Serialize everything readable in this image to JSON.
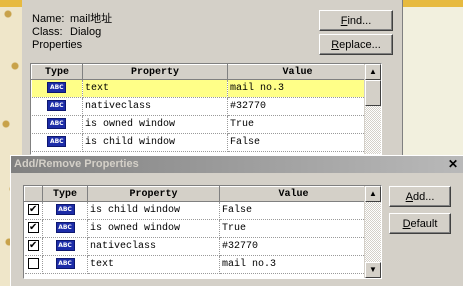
{
  "properties_window": {
    "name_label": "Name:",
    "name_value": "mail地址",
    "class_label": "Class:",
    "class_value": "Dialog",
    "properties_label": "Properties",
    "find_button": "Find...",
    "replace_button": "Replace...",
    "columns": [
      "Type",
      "Property",
      "Value"
    ],
    "rows": [
      {
        "type": "ABC",
        "property": "text",
        "value": "mail no.3",
        "selected": true
      },
      {
        "type": "ABC",
        "property": "nativeclass",
        "value": "#32770",
        "selected": false
      },
      {
        "type": "ABC",
        "property": "is owned window",
        "value": "True",
        "selected": false
      },
      {
        "type": "ABC",
        "property": "is child window",
        "value": "False",
        "selected": false
      }
    ]
  },
  "dialog": {
    "title": "Add/Remove Properties",
    "close_label": "✕",
    "add_button": "Add...",
    "default_button": "Default",
    "columns": [
      "Type",
      "Property",
      "Value"
    ],
    "rows": [
      {
        "checked": true,
        "type": "ABC",
        "property": "is child window",
        "value": "False"
      },
      {
        "checked": true,
        "type": "ABC",
        "property": "is owned window",
        "value": "True"
      },
      {
        "checked": true,
        "type": "ABC",
        "property": "nativeclass",
        "value": "#32770"
      },
      {
        "checked": false,
        "type": "ABC",
        "property": "text",
        "value": "mail no.3"
      }
    ]
  },
  "icons": {
    "type_icon": "abc-type-icon",
    "check": "✔"
  },
  "colors": {
    "selected_row": "#ffff88",
    "type_icon_bg": "#1c2ca8",
    "background": "#f2f0de"
  }
}
